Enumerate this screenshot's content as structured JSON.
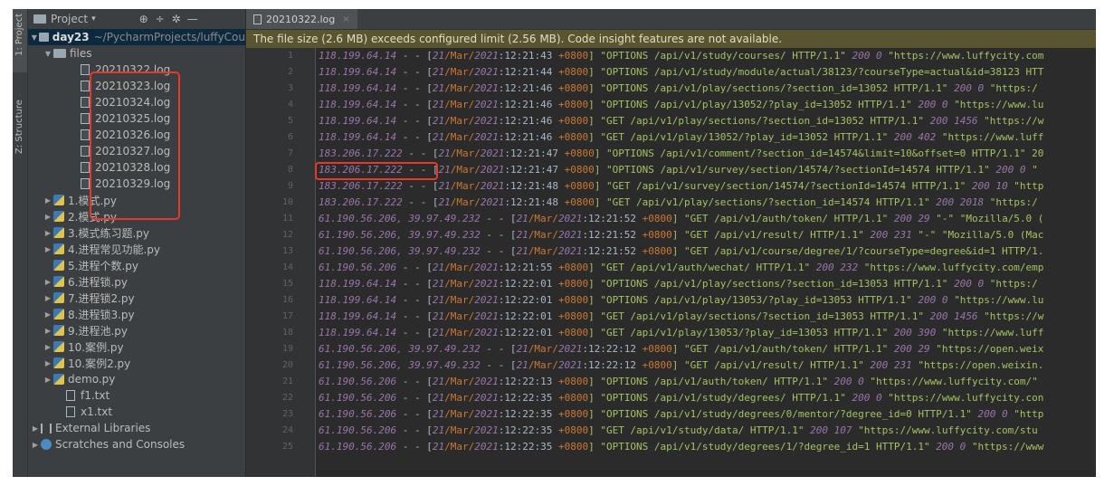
{
  "toolstrip": {
    "project_tab": "1: Project",
    "structure_tab": "Z: Structure"
  },
  "project_panel": {
    "title": "Project",
    "caret": "▾",
    "icons": {
      "target": "⊕",
      "collapse": "÷",
      "settings": "✲",
      "hide": "—"
    },
    "root": {
      "name": "day23",
      "path": "~/PycharmProjects/luffyCou"
    },
    "files_folder": "files",
    "log_files": [
      "20210322.log",
      "20210323.log",
      "20210324.log",
      "20210325.log",
      "20210326.log",
      "20210327.log",
      "20210328.log",
      "20210329.log"
    ],
    "py_files": [
      {
        "name": "1.模式.py",
        "arrow": "▶"
      },
      {
        "name": "2.模式.py",
        "arrow": "▶"
      },
      {
        "name": "3.模式练习题.py",
        "arrow": "▶"
      },
      {
        "name": "4.进程常见功能.py",
        "arrow": "▶"
      },
      {
        "name": "5.进程个数.py",
        "arrow": ""
      },
      {
        "name": "6.进程锁.py",
        "arrow": "▶"
      },
      {
        "name": "7.进程锁2.py",
        "arrow": "▶"
      },
      {
        "name": "8.进程锁3.py",
        "arrow": "▶"
      },
      {
        "name": "9.进程池.py",
        "arrow": "▶"
      },
      {
        "name": "10.案例.py",
        "arrow": "▶"
      },
      {
        "name": "10.案例2.py",
        "arrow": "▶"
      },
      {
        "name": "demo.py",
        "arrow": "▶"
      }
    ],
    "txt_files": [
      "f1.txt",
      "x1.txt"
    ],
    "external_libraries": "External Libraries",
    "scratches": "Scratches and Consoles"
  },
  "editor": {
    "tab_label": "20210322.log",
    "tab_close": "×",
    "banner": "The file size (2.6 MB) exceeds configured limit (2.56 MB). Code insight features are not available.",
    "lines": [
      {
        "n": "1",
        "ip": "118.199.64.14",
        "pre": " - - [",
        "day": "21",
        "mon": "/Mar/",
        "yr": "2021",
        "tm": ":12:21:43 ",
        "tz": "+0800",
        "req": "] \"OPTIONS /api/v1/study/courses/ HTTP/1.1\" ",
        "st": "200 0",
        "rs": " \"https://www.luffycity.com"
      },
      {
        "n": "2",
        "ip": "118.199.64.14",
        "pre": " - - [",
        "day": "21",
        "mon": "/Mar/",
        "yr": "2021",
        "tm": ":12:21:44 ",
        "tz": "+0800",
        "req": "] \"OPTIONS /api/v1/study/module/actual/38123/?courseType=actual&id=38123 HTT",
        "st": "",
        "rs": ""
      },
      {
        "n": "3",
        "ip": "118.199.64.14",
        "pre": " - - [",
        "day": "21",
        "mon": "/Mar/",
        "yr": "2021",
        "tm": ":12:21:46 ",
        "tz": "+0800",
        "req": "] \"OPTIONS /api/v1/play/sections/?section_id=13052 HTTP/1.1\" ",
        "st": "200 0",
        "rs": " \"https:/"
      },
      {
        "n": "4",
        "ip": "118.199.64.14",
        "pre": " - - [",
        "day": "21",
        "mon": "/Mar/",
        "yr": "2021",
        "tm": ":12:21:46 ",
        "tz": "+0800",
        "req": "] \"OPTIONS /api/v1/play/13052/?play_id=13052 HTTP/1.1\" ",
        "st": "200 0",
        "rs": " \"https://www.lu"
      },
      {
        "n": "5",
        "ip": "118.199.64.14",
        "pre": " - - [",
        "day": "21",
        "mon": "/Mar/",
        "yr": "2021",
        "tm": ":12:21:46 ",
        "tz": "+0800",
        "req": "] \"GET /api/v1/play/sections/?section_id=13052 HTTP/1.1\" ",
        "st": "200 1456",
        "rs": " \"https://w"
      },
      {
        "n": "6",
        "ip": "118.199.64.14",
        "pre": " - - [",
        "day": "21",
        "mon": "/Mar/",
        "yr": "2021",
        "tm": ":12:21:46 ",
        "tz": "+0800",
        "req": "] \"GET /api/v1/play/13052/?play_id=13052 HTTP/1.1\" ",
        "st": "200 402",
        "rs": " \"https://www.luff"
      },
      {
        "n": "7",
        "ip": "183.206.17.222",
        "pre": " - - [",
        "day": "21",
        "mon": "/Mar/",
        "yr": "2021",
        "tm": ":12:21:47 ",
        "tz": "+0800",
        "req": "] \"OPTIONS /api/v1/comment/?section_id=14574&limit=10&offset=0 HTTP/1.1\" 20",
        "st": "",
        "rs": ""
      },
      {
        "n": "8",
        "ip": "183.206.17.222",
        "pre": " - - [",
        "day": "21",
        "mon": "/Mar/",
        "yr": "2021",
        "tm": ":12:21:47 ",
        "tz": "+0800",
        "req": "] \"OPTIONS /api/v1/survey/section/14574/?sectionId=14574 HTTP/1.1\" ",
        "st": "200 0",
        "rs": " \""
      },
      {
        "n": "9",
        "ip": "183.206.17.222",
        "pre": " - - [",
        "day": "21",
        "mon": "/Mar/",
        "yr": "2021",
        "tm": ":12:21:48 ",
        "tz": "+0800",
        "req": "] \"GET /api/v1/survey/section/14574/?sectionId=14574 HTTP/1.1\" ",
        "st": "200 10",
        "rs": " \"http"
      },
      {
        "n": "10",
        "ip": "183.206.17.222",
        "pre": " - - [",
        "day": "21",
        "mon": "/Mar/",
        "yr": "2021",
        "tm": ":12:21:48 ",
        "tz": "+0800",
        "req": "] \"GET /api/v1/play/sections/?section_id=14574 HTTP/1.1\" ",
        "st": "200 2018",
        "rs": " \"https:/"
      },
      {
        "n": "11",
        "ip": "61.190.56.206, 39.97.49.232",
        "pre": " - - [",
        "day": "21",
        "mon": "/Mar/",
        "yr": "2021",
        "tm": ":12:21:52 ",
        "tz": "+0800",
        "req": "] \"GET /api/v1/auth/token/ HTTP/1.1\" ",
        "st": "200 29",
        "rs": " \"-\" \"Mozilla/5.0 ("
      },
      {
        "n": "12",
        "ip": "61.190.56.206, 39.97.49.232",
        "pre": " - - [",
        "day": "21",
        "mon": "/Mar/",
        "yr": "2021",
        "tm": ":12:21:52 ",
        "tz": "+0800",
        "req": "] \"GET /api/v1/result/ HTTP/1.1\" ",
        "st": "200 231",
        "rs": " \"-\" \"Mozilla/5.0 (Mac"
      },
      {
        "n": "13",
        "ip": "61.190.56.206, 39.97.49.232",
        "pre": " - - [",
        "day": "21",
        "mon": "/Mar/",
        "yr": "2021",
        "tm": ":12:21:52 ",
        "tz": "+0800",
        "req": "] \"GET /api/v1/course/degree/1/?courseType=degree&id=1 HTTP/1.",
        "st": "",
        "rs": ""
      },
      {
        "n": "14",
        "ip": "61.190.56.206",
        "pre": " - - [",
        "day": "21",
        "mon": "/Mar/",
        "yr": "2021",
        "tm": ":12:21:55 ",
        "tz": "+0800",
        "req": "] \"GET /api/v1/auth/wechat/ HTTP/1.1\" ",
        "st": "200 232",
        "rs": " \"https://www.luffycity.com/emp"
      },
      {
        "n": "15",
        "ip": "118.199.64.14",
        "pre": " - - [",
        "day": "21",
        "mon": "/Mar/",
        "yr": "2021",
        "tm": ":12:22:01 ",
        "tz": "+0800",
        "req": "] \"OPTIONS /api/v1/play/sections/?section_id=13053 HTTP/1.1\" ",
        "st": "200 0",
        "rs": " \"https:/"
      },
      {
        "n": "16",
        "ip": "118.199.64.14",
        "pre": " - - [",
        "day": "21",
        "mon": "/Mar/",
        "yr": "2021",
        "tm": ":12:22:01 ",
        "tz": "+0800",
        "req": "] \"OPTIONS /api/v1/play/13053/?play_id=13053 HTTP/1.1\" ",
        "st": "200 0",
        "rs": " \"https://www.lu"
      },
      {
        "n": "17",
        "ip": "118.199.64.14",
        "pre": " - - [",
        "day": "21",
        "mon": "/Mar/",
        "yr": "2021",
        "tm": ":12:22:01 ",
        "tz": "+0800",
        "req": "] \"GET /api/v1/play/sections/?section_id=13053 HTTP/1.1\" ",
        "st": "200 1456",
        "rs": " \"https://w"
      },
      {
        "n": "18",
        "ip": "118.199.64.14",
        "pre": " - - [",
        "day": "21",
        "mon": "/Mar/",
        "yr": "2021",
        "tm": ":12:22:01 ",
        "tz": "+0800",
        "req": "] \"GET /api/v1/play/13053/?play_id=13053 HTTP/1.1\" ",
        "st": "200 390",
        "rs": " \"https://www.luff"
      },
      {
        "n": "19",
        "ip": "61.190.56.206, 39.97.49.232",
        "pre": " - - [",
        "day": "21",
        "mon": "/Mar/",
        "yr": "2021",
        "tm": ":12:22:12 ",
        "tz": "+0800",
        "req": "] \"GET /api/v1/auth/token/ HTTP/1.1\" ",
        "st": "200 29",
        "rs": " \"https://open.weix"
      },
      {
        "n": "20",
        "ip": "61.190.56.206, 39.97.49.232",
        "pre": " - - [",
        "day": "21",
        "mon": "/Mar/",
        "yr": "2021",
        "tm": ":12:22:12 ",
        "tz": "+0800",
        "req": "] \"GET /api/v1/result/ HTTP/1.1\" ",
        "st": "200 231",
        "rs": " \"https://open.weixin."
      },
      {
        "n": "21",
        "ip": "61.190.56.206",
        "pre": " - - [",
        "day": "21",
        "mon": "/Mar/",
        "yr": "2021",
        "tm": ":12:22:13 ",
        "tz": "+0800",
        "req": "] \"OPTIONS /api/v1/auth/token/ HTTP/1.1\" ",
        "st": "200 0",
        "rs": " \"https://www.luffycity.com/\" "
      },
      {
        "n": "22",
        "ip": "61.190.56.206",
        "pre": " - - [",
        "day": "21",
        "mon": "/Mar/",
        "yr": "2021",
        "tm": ":12:22:35 ",
        "tz": "+0800",
        "req": "] \"OPTIONS /api/v1/study/degrees/ HTTP/1.1\" ",
        "st": "200 0",
        "rs": " \"https://www.luffycity.con"
      },
      {
        "n": "23",
        "ip": "61.190.56.206",
        "pre": " - - [",
        "day": "21",
        "mon": "/Mar/",
        "yr": "2021",
        "tm": ":12:22:35 ",
        "tz": "+0800",
        "req": "] \"OPTIONS /api/v1/study/degrees/0/mentor/?degree_id=0 HTTP/1.1\" ",
        "st": "200 0",
        "rs": " \"http"
      },
      {
        "n": "24",
        "ip": "61.190.56.206",
        "pre": " - - [",
        "day": "21",
        "mon": "/Mar/",
        "yr": "2021",
        "tm": ":12:22:35 ",
        "tz": "+0800",
        "req": "] \"GET /api/v1/study/data/ HTTP/1.1\" ",
        "st": "200 107",
        "rs": " \"https://www.luffycity.com/stu"
      },
      {
        "n": "25",
        "ip": "61.190.56.206",
        "pre": " - - [",
        "day": "21",
        "mon": "/Mar/",
        "yr": "2021",
        "tm": ":12:22:35 ",
        "tz": "+0800",
        "req": "] \"OPTIONS /api/v1/study/degrees/1/?degree_id=1 HTTP/1.1\" ",
        "st": "200 0",
        "rs": " \"https://www"
      }
    ]
  },
  "colors": {
    "ide_bg": "#2b2b2b",
    "panel_bg": "#3c3f41",
    "banner_bg": "#5a5531",
    "highlight_box": "#e8372c",
    "ip_color": "#9876aa",
    "string_color": "#a5c261"
  }
}
